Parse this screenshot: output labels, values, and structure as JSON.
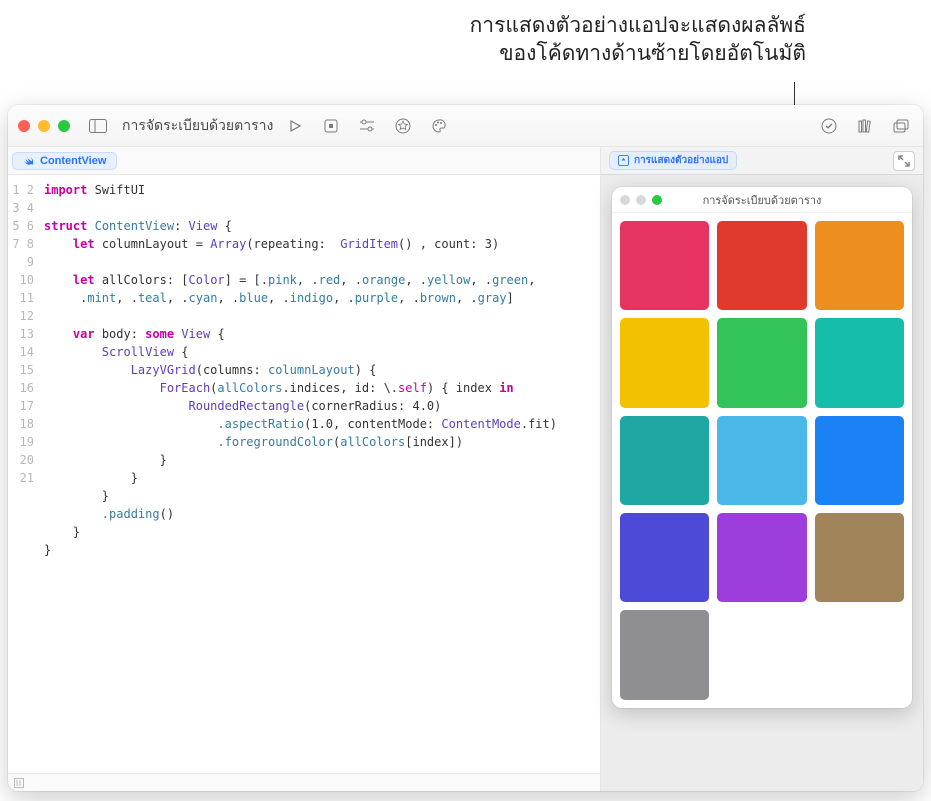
{
  "annotation": {
    "line1": "การแสดงตัวอย่างแอปจะแสดงผลลัพธ์",
    "line2": "ของโค้ดทางด้านซ้ายโดยอัตโนมัติ"
  },
  "toolbar": {
    "title": "การจัดระเบียบด้วยตาราง"
  },
  "tab": {
    "file_label": "ContentView"
  },
  "code": {
    "line_count": 21,
    "c1": "import",
    "c1b": "SwiftUI",
    "c3a": "struct",
    "c3b": "ContentView",
    "c3c": "View",
    "c4a": "let",
    "c4b": "columnLayout =",
    "c4c": "Array",
    "c4d": "(repeating:",
    "c4e": "GridItem",
    "c4f": "() , count: 3)",
    "c6a": "let",
    "c6b": "allColors: [",
    "c6c": "Color",
    "c6d": "] = [.",
    "c6e": "pink",
    "c6f": ", .",
    "c6g": "red",
    "c6h": "orange",
    "c6i": "yellow",
    "c6j": "green",
    "c6k": "mint",
    "c6l": "teal",
    "c6m": "cyan",
    "c6n": "blue",
    "c6o": "indigo",
    "c6p": "purple",
    "c6q": "brown",
    "c6r": "gray",
    "c8a": "var",
    "c8b": "body:",
    "c8c": "some",
    "c8d": "View",
    "c9": "ScrollView",
    "c10a": "LazyVGrid",
    "c10b": "(columns:",
    "c10c": "columnLayout",
    "c10d": ") {",
    "c11a": "ForEach",
    "c11b": "(",
    "c11c": "allColors",
    "c11d": ".indices, id: \\.",
    "c11e": "self",
    "c11f": ") { index",
    "c11g": "in",
    "c12a": "RoundedRectangle",
    "c12b": "(cornerRadius: 4.0)",
    "c13a": ".aspectRatio",
    "c13b": "(1.0, contentMode:",
    "c13c": "ContentMode",
    "c13d": ".fit)",
    "c14a": ".foregroundColor",
    "c14b": "(",
    "c14c": "allColors",
    "c14d": "[index])",
    "c18a": ".padding",
    "c18b": "()"
  },
  "preview": {
    "chip_label": "การแสดงตัวอย่างแอป",
    "sim_title": "การจัดระเบียบด้วยตาราง"
  },
  "colors": [
    "#e63462",
    "#e03a2f",
    "#ee8e1e",
    "#f2c200",
    "#32c459",
    "#15beab",
    "#1fa7a3",
    "#4ab8e8",
    "#1b82f6",
    "#4e4ad8",
    "#9d3ddb",
    "#a08358",
    "#8e8e93"
  ]
}
